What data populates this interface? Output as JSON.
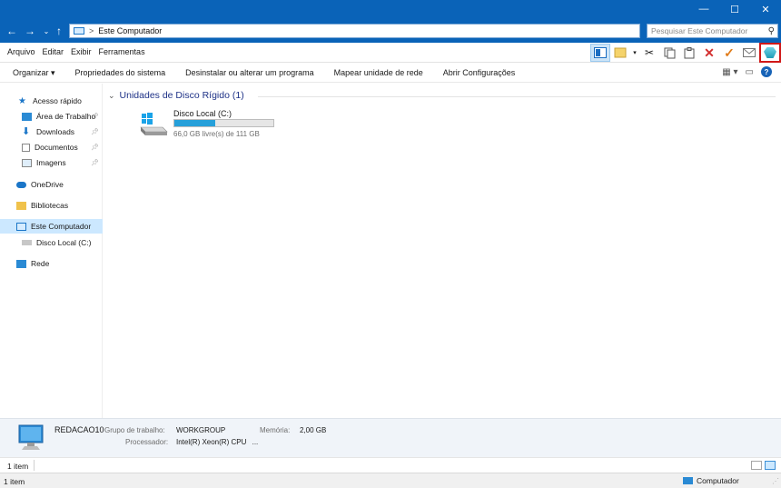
{
  "window": {
    "controls": {
      "minimize": "—",
      "maximize": "☐",
      "close": "✕"
    }
  },
  "address": {
    "separator": ">",
    "path": "Este Computador"
  },
  "search": {
    "placeholder": "Pesquisar Este Computador"
  },
  "menu": [
    "Arquivo",
    "Editar",
    "Exibir",
    "Ferramentas"
  ],
  "toolbar_icons": [
    "preview-pane-icon",
    "folder-options-icon",
    "cut-icon",
    "copy-icon",
    "paste-icon",
    "delete-icon",
    "confirm-icon",
    "mail-icon",
    "gem-icon"
  ],
  "commands": [
    "Organizar ▾",
    "Propriedades do sistema",
    "Desinstalar ou alterar um programa",
    "Mapear unidade de rede",
    "Abrir Configurações"
  ],
  "nav": {
    "items": [
      {
        "label": "Acesso rápido",
        "icon": "star-icon",
        "pinned": false
      },
      {
        "label": "Área de Trabalho",
        "icon": "desktop-icon",
        "pinned": true
      },
      {
        "label": "Downloads",
        "icon": "download-icon",
        "pinned": true
      },
      {
        "label": "Documentos",
        "icon": "document-icon",
        "pinned": true
      },
      {
        "label": "Imagens",
        "icon": "image-icon",
        "pinned": true
      },
      {
        "label": "OneDrive",
        "icon": "cloud-icon",
        "pinned": false
      },
      {
        "label": "Bibliotecas",
        "icon": "library-icon",
        "pinned": false
      },
      {
        "label": "Este Computador",
        "icon": "computer-icon",
        "pinned": false,
        "selected": true
      },
      {
        "label": "Disco Local (C:)",
        "icon": "drive-icon",
        "pinned": false
      },
      {
        "label": "Rede",
        "icon": "network-icon",
        "pinned": false
      }
    ]
  },
  "content": {
    "group_title": "Unidades de Disco Rígido (1)",
    "drive": {
      "name": "Disco Local (C:)",
      "free_text": "66,0 GB livre(s) de 111 GB",
      "used_fraction": 0.41
    }
  },
  "details": {
    "computer_name": "REDACAO10",
    "workgroup_label": "Grupo de trabalho:",
    "workgroup_value": "WORKGROUP",
    "memory_label": "Memória:",
    "memory_value": "2,00 GB",
    "processor_label": "Processador:",
    "processor_value": "Intel(R) Xeon(R) CPU",
    "processor_ellipsis": "..."
  },
  "status": {
    "item_count": "1 item",
    "item_count_bottom": "1 item",
    "location": "Computador"
  },
  "colors": {
    "titlebar": "#0a63b8",
    "accent": "#26a0da",
    "group_header": "#1e3287",
    "highlight_border": "#d01818"
  }
}
